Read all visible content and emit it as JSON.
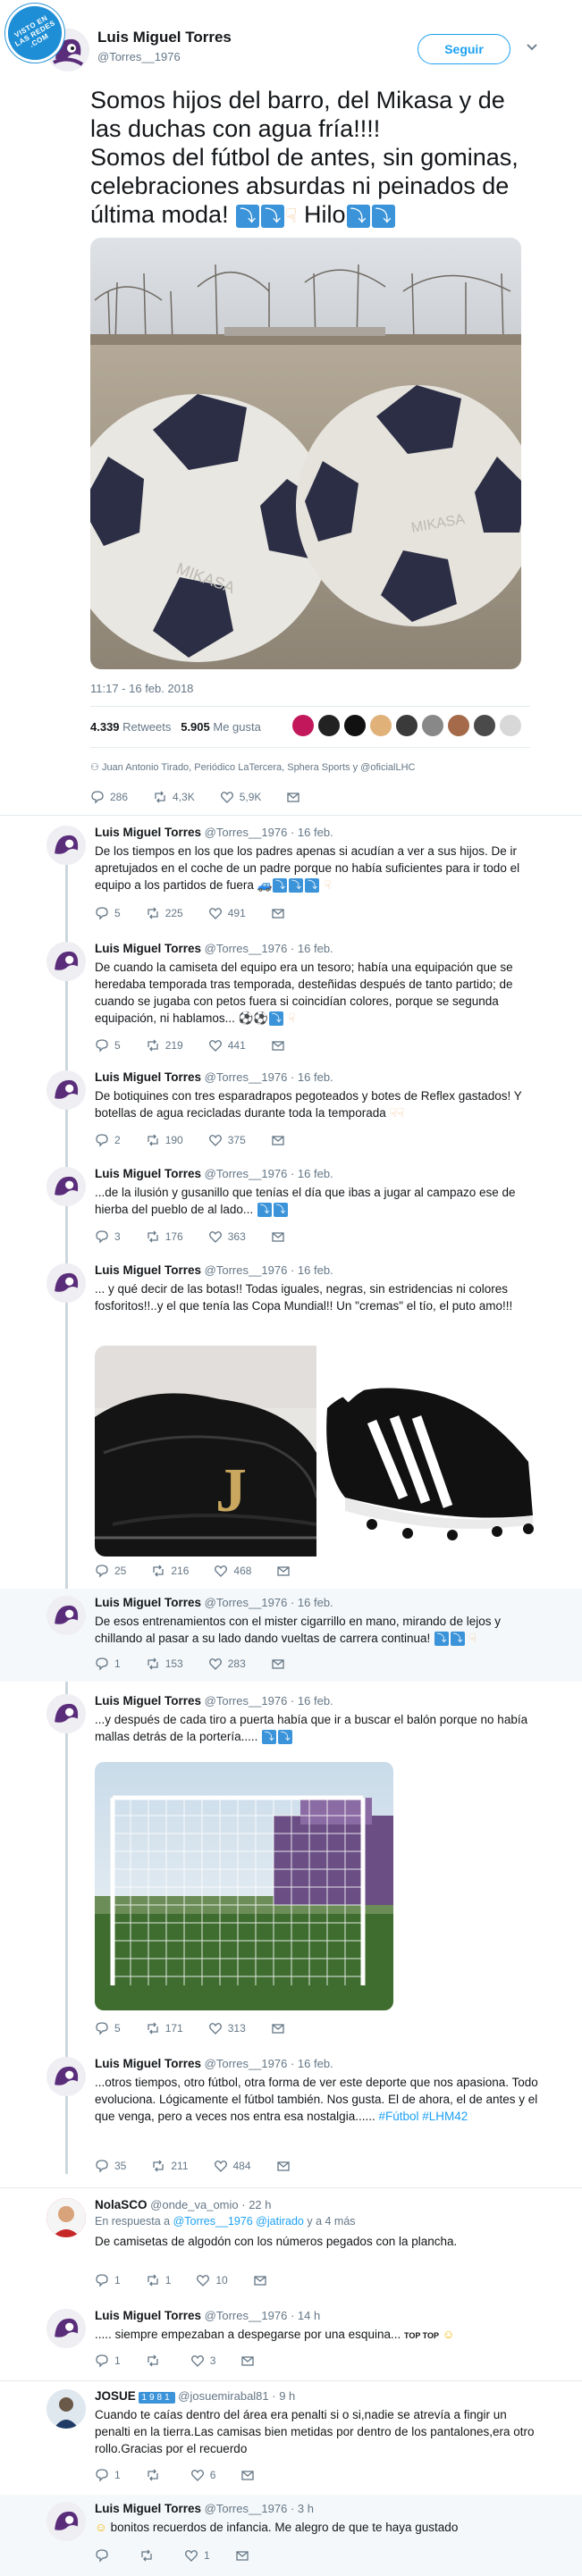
{
  "watermark": "VISTO EN LAS REDES .COM",
  "main": {
    "name": "Luis Miguel Torres",
    "handle": "@Torres__1976",
    "follow_label": "Seguir",
    "text_1": "Somos hijos del barro, del Mikasa y de las duchas con agua fría!!!!",
    "text_2": "Somos del fútbol de antes, sin gominas, celebraciones absurdas ni peinados de última moda!",
    "text_hilo": "Hilo",
    "timestamp": "11:17 - 16 feb. 2018",
    "retweets_count": "4.339",
    "retweets_label": "Retweets",
    "likes_count": "5.905",
    "likes_label": "Me gusta",
    "likers_names": "Juan Antonio Tirado, Periódico LaTercera, Sphera Sports y @oficialLHC",
    "replies": "286",
    "rts": "4,3K",
    "favs": "5,9K"
  },
  "tweets": [
    {
      "name": "Luis Miguel Torres",
      "handle": "@Torres__1976",
      "date": "· 16 feb.",
      "text": "De los tiempos en los que los padres apenas si acudían a ver a sus hijos. De ir apretujados en el coche de un padre porque no había suficientes para ir todo el equipo a los partidos de fuera",
      "r": "5",
      "rt": "225",
      "f": "491"
    },
    {
      "name": "Luis Miguel Torres",
      "handle": "@Torres__1976",
      "date": "· 16 feb.",
      "text": "De cuando la camiseta del equipo era un tesoro; había una equipación que se heredaba temporada tras temporada, desteñidas después de tanto partido; de cuando se jugaba con petos fuera si coincidían colores, porque se segunda equipación, ni hablamos...",
      "r": "5",
      "rt": "219",
      "f": "441"
    },
    {
      "name": "Luis Miguel Torres",
      "handle": "@Torres__1976",
      "date": "· 16 feb.",
      "text": "De botiquines con tres esparadrapos pegoteados y botes de Reflex gastados! Y botellas de agua recicladas durante toda la temporada",
      "r": "2",
      "rt": "190",
      "f": "375"
    },
    {
      "name": "Luis Miguel Torres",
      "handle": "@Torres__1976",
      "date": "· 16 feb.",
      "text": "...de la ilusión y gusanillo que tenías el día que ibas a jugar al campazo ese de hierba del pueblo de al lado...",
      "r": "3",
      "rt": "176",
      "f": "363"
    },
    {
      "name": "Luis Miguel Torres",
      "handle": "@Torres__1976",
      "date": "· 16 feb.",
      "text": "... y qué decir de las botas!! Todas iguales, negras, sin estridencias ni colores fosforitos!!..y el que tenía las Copa Mundial!! Un \"cremas\" el tío, el puto amo!!!",
      "r": "25",
      "rt": "216",
      "f": "468"
    },
    {
      "name": "Luis Miguel Torres",
      "handle": "@Torres__1976",
      "date": "· 16 feb.",
      "text": "De esos entrenamientos con el mister cigarrillo en mano, mirando de lejos y chillando al pasar a su lado dando vueltas de carrera continua!",
      "r": "1",
      "rt": "153",
      "f": "283"
    },
    {
      "name": "Luis Miguel Torres",
      "handle": "@Torres__1976",
      "date": "· 16 feb.",
      "text": "...y después de cada tiro a puerta había que ir a buscar el balón porque no había mallas detrás de la portería.....",
      "r": "5",
      "rt": "171",
      "f": "313"
    },
    {
      "name": "Luis Miguel Torres",
      "handle": "@Torres__1976",
      "date": "· 16 feb.",
      "text": "...otros tiempos, otro fútbol, otra forma de ver este deporte que nos apasiona. Todo evoluciona. Lógicamente el fútbol también. Nos gusta. El de ahora, el de antes y el que venga, pero a veces nos entra esa nostalgia......",
      "tags": "#Fútbol #LHM42",
      "r": "35",
      "rt": "211",
      "f": "484"
    }
  ],
  "replies": [
    {
      "name": "NolaSCO",
      "handle": "@onde_va_omio",
      "date": "· 22 h",
      "reply_prefix": "En respuesta a",
      "reply_to": "@Torres__1976 @jatirado",
      "reply_suffix": "y a 4 más",
      "text": "De camisetas de algodón con los números pegados con la plancha.",
      "r": "1",
      "rt": "1",
      "f": "10"
    },
    {
      "name": "Luis Miguel Torres",
      "handle": "@Torres__1976",
      "date": "· 14 h",
      "text": "..... siempre empezaban a despegarse por una esquina...",
      "r": "1",
      "rt": "",
      "f": "3"
    },
    {
      "name": "JOSUE",
      "handle": "@josuemirabal81",
      "date": "· 9 h",
      "badge": "1981",
      "text": "Cuando te caías dentro del área era penalti si o si,nadie se atrevía a fingir un penalti en la tierra.Las camisas bien metidas por dentro de los pantalones,era otro rollo.Gracias por el recuerdo",
      "r": "1",
      "rt": "",
      "f": "6"
    },
    {
      "name": "Luis Miguel Torres",
      "handle": "@Torres__1976",
      "date": "· 3 h",
      "text": "bonitos recuerdos de infancia. Me alegro de que te haya gustado",
      "r": "",
      "rt": "",
      "f": "1"
    }
  ],
  "boot_brand": "J",
  "ball_brand": "MIKASA"
}
